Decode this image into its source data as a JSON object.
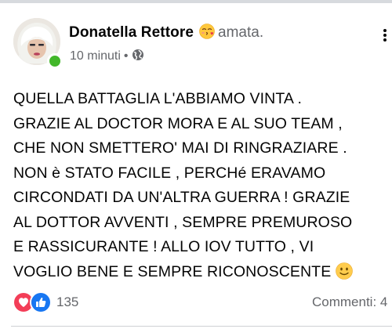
{
  "post": {
    "author": "Donatella Rettore",
    "feeling_icon": "blowing-kiss-emoji",
    "feeling": "amata.",
    "time": "10 minuti",
    "meta_sep": "•",
    "audience_icon": "globe-icon",
    "lines": [
      "QUELLA BATTAGLIA L'ABBIAMO VINTA .",
      "GRAZIE AL DOCTOR MORA E AL SUO TEAM ,",
      "CHE NON SMETTERO' MAI DI RINGRAZIARE .",
      "NON è STATO FACILE , PERCHé ERAVAMO",
      "CIRCONDATI DA UN'ALTRA GUERRA ! GRAZIE",
      "AL DOTTOR AVVENTI , SEMPRE PREMUROSO",
      "E RASSICURANTE ! ALLO IOV TUTTO , VI",
      "VOGLIO BENE E SEMPRE RICONOSCENTE"
    ],
    "end_emoji": "slightly-smiling-face-emoji"
  },
  "footer": {
    "reaction_icons": [
      "love-reaction-icon",
      "like-reaction-icon"
    ],
    "reactions_count": "135",
    "comments": "Commenti: 4"
  },
  "colors": {
    "text": "#050505",
    "secondary": "#65676b",
    "online": "#42b72a",
    "like": "#1877f2",
    "love": "#f33e58"
  }
}
